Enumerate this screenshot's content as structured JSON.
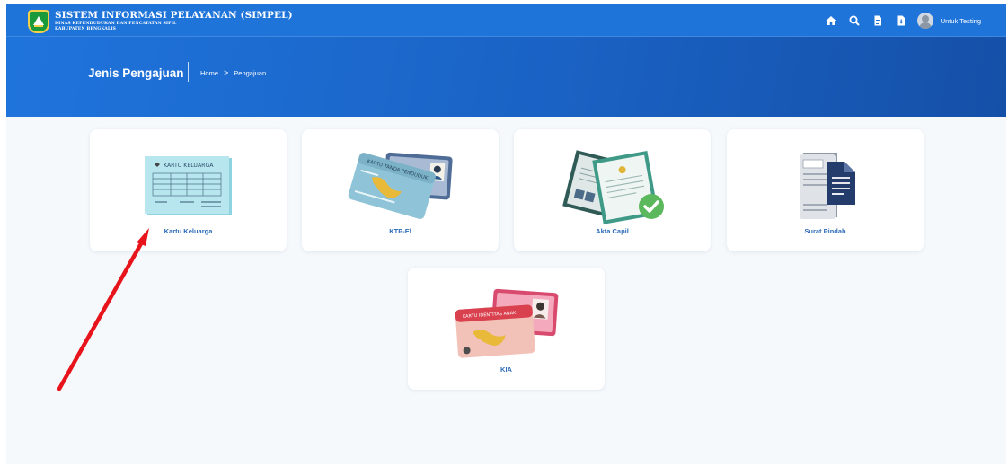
{
  "header": {
    "app_title": "SISTEM INFORMASI PELAYANAN (SIMPEL)",
    "app_subtitle_1": "DINAS KEPENDUDUKAN DAN PENCATATAN SIPIL",
    "app_subtitle_2": "KABUPATEN BENGKALIS",
    "icons": [
      "home-icon",
      "search-icon",
      "document-icon",
      "document-download-icon"
    ],
    "user_name": "Untuk Testing"
  },
  "hero": {
    "page_title": "Jenis Pengajuan",
    "breadcrumb": [
      "Home",
      ">",
      "Pengajuan"
    ]
  },
  "cards": [
    {
      "label": "Kartu Keluarga",
      "illustration_text": "KARTU KELUARGA"
    },
    {
      "label": "KTP-El",
      "illustration_text": "KARTU TANDA PENDUDUK"
    },
    {
      "label": "Akta Capil"
    },
    {
      "label": "Surat Pindah"
    },
    {
      "label": "KIA",
      "illustration_text": "KARTU IDENTITAS ANAK"
    }
  ],
  "colors": {
    "primary": "#1e74d9",
    "card_label": "#2b6bb8",
    "annotation_arrow": "#e8141b"
  }
}
